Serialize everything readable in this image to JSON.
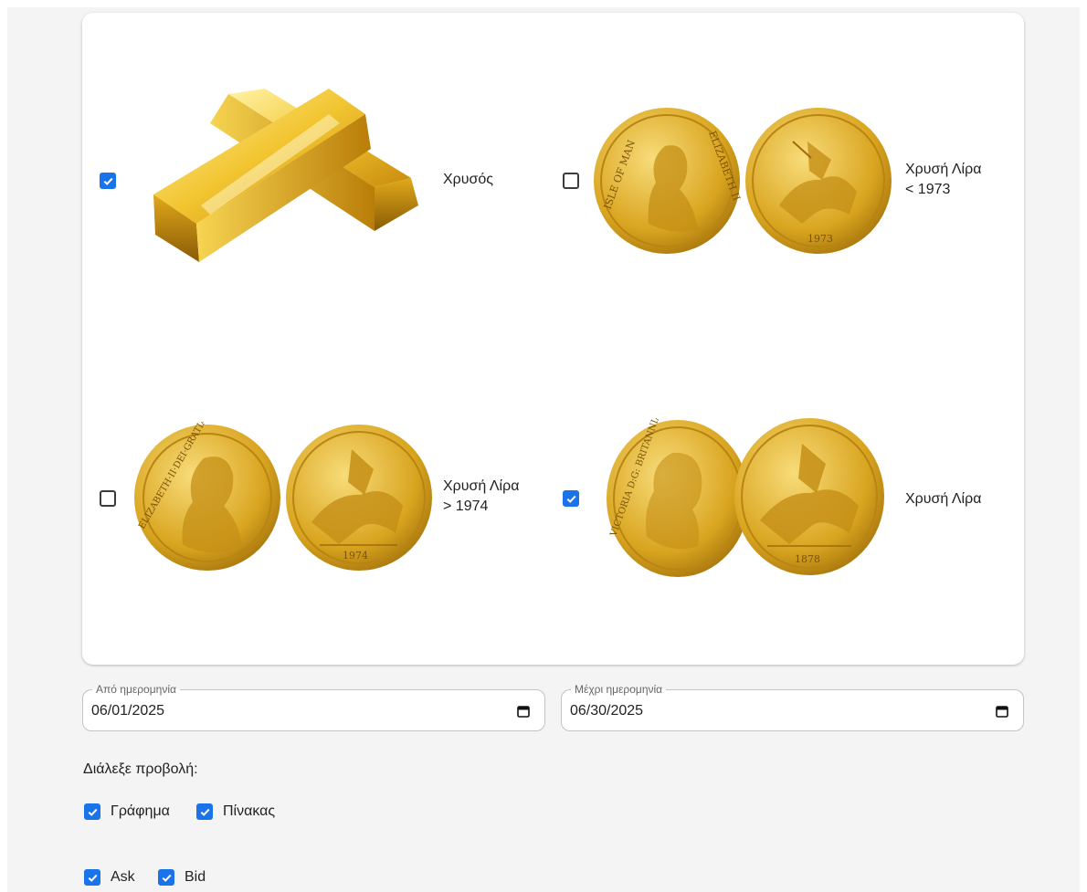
{
  "products": [
    {
      "label_lines": [
        "Χρυσός"
      ],
      "checked": true,
      "icon": "gold-bars-image"
    },
    {
      "label_lines": [
        "Χρυσή Λίρα",
        "< 1973"
      ],
      "checked": false,
      "icon": "sovereign-pre-1973-image"
    },
    {
      "label_lines": [
        "Χρυσή Λίρα",
        "> 1974"
      ],
      "checked": false,
      "icon": "sovereign-post-1974-image"
    },
    {
      "label_lines": [
        "Χρυσή Λίρα"
      ],
      "checked": true,
      "icon": "sovereign-victoria-image"
    }
  ],
  "dates": {
    "from": {
      "legend": "Από ημερομηνία",
      "value": "06/01/2025"
    },
    "to": {
      "legend": "Μέχρι ημερομηνία",
      "value": "06/30/2025"
    }
  },
  "view": {
    "title": "Διάλεξε προβολή:",
    "chart": {
      "label": "Γράφημα",
      "checked": true
    },
    "table": {
      "label": "Πίνακας",
      "checked": true
    }
  },
  "price_type": {
    "ask": {
      "label": "Ask",
      "checked": true
    },
    "bid": {
      "label": "Bid",
      "checked": true
    }
  },
  "colors": {
    "accent": "#1a73e8",
    "gold": "#d9a520",
    "background": "#f4f4f4"
  },
  "coin_text": {
    "isle_of_man": "ISLE OF MAN",
    "elizabeth_ii": "ELIZABETH II",
    "year_1973": "1973",
    "year_1974": "1974",
    "year_1878": "1878",
    "dei_gratia": "ELIZABETH·II·DEI·GRATIA·REGINA·F·D",
    "victoria": "VICTORIA D:G: BRITANNIAR: REG: F:D:"
  }
}
